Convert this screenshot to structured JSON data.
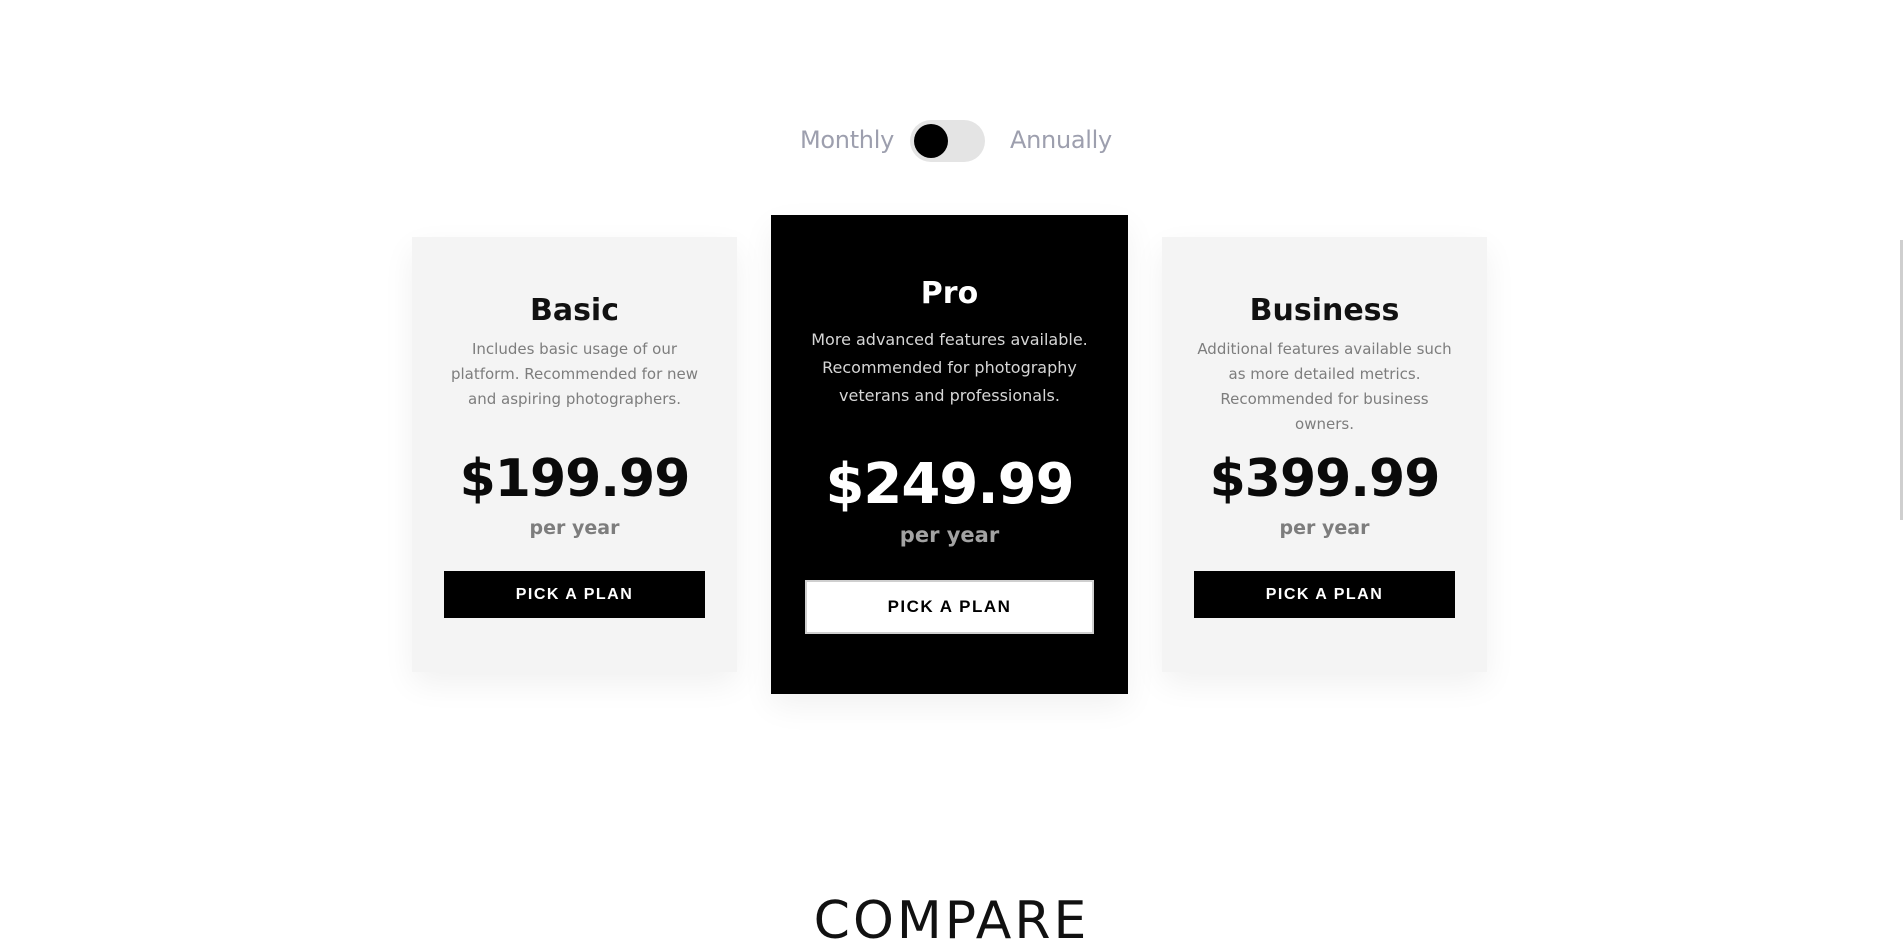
{
  "billing_toggle": {
    "monthly_label": "Monthly",
    "annually_label": "Annually",
    "state": "monthly"
  },
  "plans": [
    {
      "name": "Basic",
      "description": "Includes basic usage of our platform. Recommended for new and aspiring photographers.",
      "price": "$199.99",
      "period": "per year",
      "button_label": "PICK A PLAN"
    },
    {
      "name": "Pro",
      "description": "More advanced features available. Recommended for photography veterans and professionals.",
      "price": "$249.99",
      "period": "per year",
      "button_label": "PICK A PLAN",
      "featured": true
    },
    {
      "name": "Business",
      "description": "Additional features available such as more detailed metrics. Recommended for business owners.",
      "price": "$399.99",
      "period": "per year",
      "button_label": "PICK A PLAN"
    }
  ],
  "compare": {
    "title": "COMPARE"
  },
  "colors": {
    "background": "#ffffff",
    "card_light": "#f4f4f4",
    "card_featured": "#000000",
    "accent_text": "#9d9fae",
    "button_dark": "#000000"
  }
}
